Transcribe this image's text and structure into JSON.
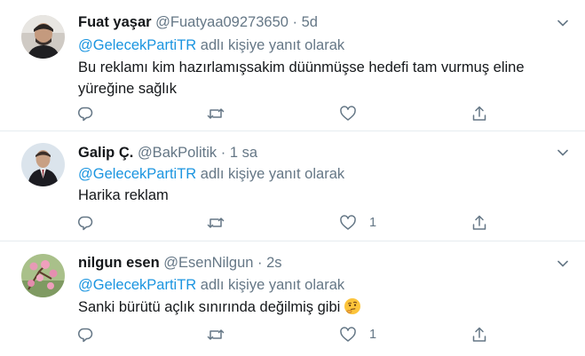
{
  "tweets": [
    {
      "name": "Fuat yaşar",
      "handle": "@Fuatyaa09273650",
      "separator": "·",
      "time": "5d",
      "reply_to": "@GelecekPartiTR",
      "reply_suffix": "adlı kişiye yanıt olarak",
      "text_lines": [
        "Bu reklamı kim hazırlamışsakim düünmüşse hedefi tam vurmuş eline",
        "yüreğine sağlık"
      ],
      "like_count": "",
      "avatar_icon": "man-portrait-avatar"
    },
    {
      "name": "Galip Ç.",
      "handle": "@BakPolitik",
      "separator": "·",
      "time": "1 sa",
      "reply_to": "@GelecekPartiTR",
      "reply_suffix": "adlı kişiye yanıt olarak",
      "text_lines": [
        "Harika reklam"
      ],
      "like_count": "1",
      "avatar_icon": "man-in-suit-avatar"
    },
    {
      "name": "nilgun esen",
      "handle": "@EsenNilgun",
      "separator": "·",
      "time": "2s",
      "reply_to": "@GelecekPartiTR",
      "reply_suffix": "adlı kişiye yanıt olarak",
      "text_lines": [
        "Sanki bürütü açlık sınırında değilmiş gibi"
      ],
      "like_count": "1",
      "avatar_icon": "pink-blossom-avatar",
      "emoji_icon": "thinking-face-emoji"
    }
  ],
  "colors": {
    "link": "#1b95e0",
    "muted": "#657786",
    "text": "#14171a",
    "divider": "#e6ecf0"
  }
}
